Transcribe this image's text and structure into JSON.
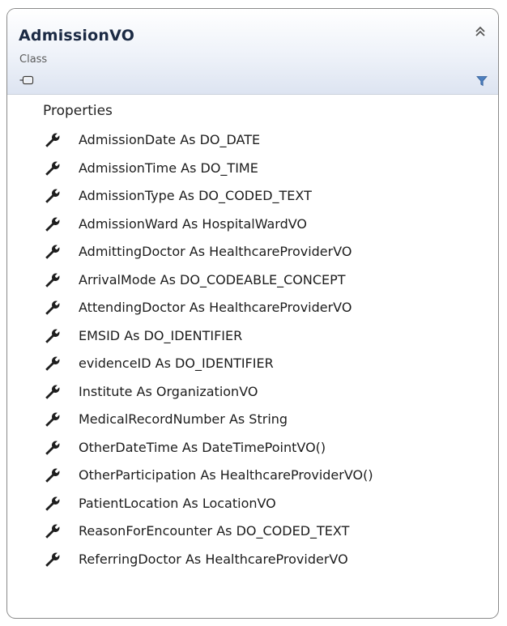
{
  "class_shape": {
    "name": "AdmissionVO",
    "stereotype": "Class",
    "collapse_icon": "double-chevron-up-icon",
    "type_icon": "class-icon",
    "filter_icon": "filter-icon",
    "colors": {
      "header_top": "#ffffff",
      "header_bottom": "#dde4f1",
      "border": "#8a8a8a",
      "name_text": "#1b2a44",
      "filter_blue": "#4d7fbf"
    }
  },
  "properties_section": {
    "title": "Properties",
    "expanded": true,
    "item_icon": "wrench-icon",
    "items": [
      "AdmissionDate As DO_DATE",
      "AdmissionTime As DO_TIME",
      "AdmissionType As DO_CODED_TEXT",
      "AdmissionWard As HospitalWardVO",
      "AdmittingDoctor As HealthcareProviderVO",
      "ArrivalMode As DO_CODEABLE_CONCEPT",
      "AttendingDoctor As HealthcareProviderVO",
      "EMSID As DO_IDENTIFIER",
      "evidenceID As DO_IDENTIFIER",
      "Institute As OrganizationVO",
      "MedicalRecordNumber As String",
      "OtherDateTime As DateTimePointVO()",
      "OtherParticipation As HealthcareProviderVO()",
      "PatientLocation As LocationVO",
      "ReasonForEncounter As DO_CODED_TEXT",
      "ReferringDoctor As HealthcareProviderVO"
    ]
  }
}
